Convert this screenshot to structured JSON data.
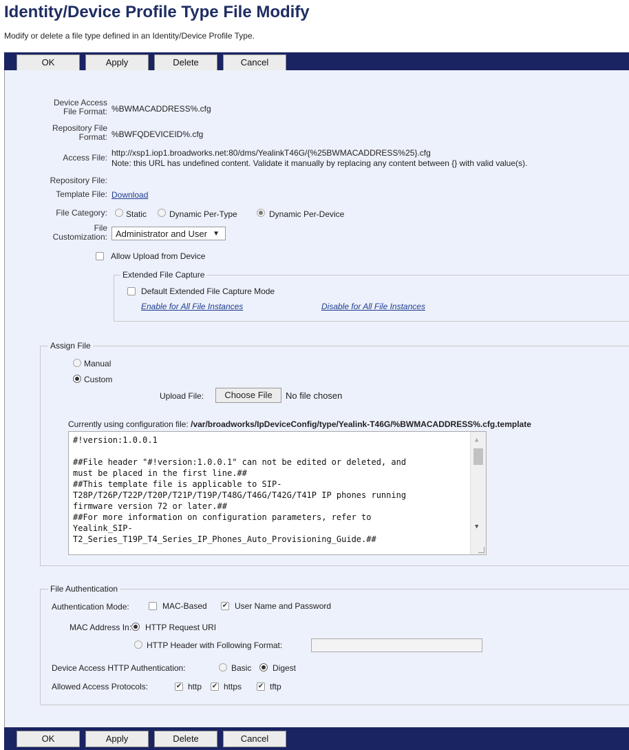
{
  "page": {
    "title": "Identity/Device Profile Type File Modify",
    "subtitle": "Modify or delete a file type defined in an Identity/Device Profile Type."
  },
  "buttons": {
    "ok": "OK",
    "apply": "Apply",
    "delete": "Delete",
    "cancel": "Cancel"
  },
  "fields": {
    "device_access_label": "Device Access File Format:",
    "device_access_value": "%BWMACADDRESS%.cfg",
    "repository_format_label": "Repository File Format:",
    "repository_format_value": "%BWFQDEVICEID%.cfg",
    "access_file_label": "Access File:",
    "access_file_value": "http://xsp1.iop1.broadworks.net:80/dms/YealinkT46G/{%25BWMACADDRESS%25}.cfg",
    "access_file_note": "Note: this URL has undefined content. Validate it manually by replacing any content between {} with valid value(s).",
    "repository_file_label": "Repository File:",
    "template_file_label": "Template File:",
    "template_file_link": "Download",
    "file_category_label": "File Category:",
    "file_category_options": [
      "Static",
      "Dynamic Per-Type",
      "Dynamic Per-Device"
    ],
    "file_category_selected": "Dynamic Per-Device",
    "file_customization_label_1": "File",
    "file_customization_label_2": "Customization:",
    "file_customization_value": "Administrator and User",
    "allow_upload_label": "Allow Upload from Device",
    "allow_upload_checked": false
  },
  "extended_capture": {
    "legend": "Extended File Capture",
    "default_mode_label": "Default Extended File Capture Mode",
    "default_mode_checked": false,
    "enable_all": "Enable for All File Instances",
    "disable_all": "Disable for All File Instances"
  },
  "assign_file": {
    "legend": "Assign File",
    "manual_label": "Manual",
    "custom_label": "Custom",
    "selected": "Custom",
    "upload_label": "Upload File:",
    "choose_button": "Choose File",
    "no_file_text": "No file chosen",
    "config_prefix": "Currently using configuration file:",
    "config_path": "/var/broadworks/IpDeviceConfig/type/Yealink-T46G/%BWMACADDRESS%.cfg.template",
    "template_lines": [
      "#!version:1.0.0.1",
      "",
      "##File header \"#!version:1.0.0.1\" can not be edited or deleted, and",
      "must be placed in the first line.##",
      "##This template file is applicable to SIP-",
      "T28P/T26P/T22P/T20P/T21P/T19P/T48G/T46G/T42G/T41P IP phones running",
      "firmware version 72 or later.##",
      "##For more information on configuration parameters, refer to",
      "Yealink_SIP-",
      "T2_Series_T19P_T4_Series_IP_Phones_Auto_Provisioning_Guide.##"
    ]
  },
  "file_auth": {
    "legend": "File Authentication",
    "auth_mode_label": "Authentication Mode:",
    "mac_based_label": "MAC-Based",
    "mac_based_checked": false,
    "user_pass_label": "User Name and Password",
    "user_pass_checked": true,
    "mac_in_label": "MAC Address In:",
    "http_request_uri": "HTTP Request URI",
    "http_header_label": "HTTP Header with Following Format:",
    "mac_in_selected": "HTTP Request URI",
    "http_header_value": "",
    "device_http_auth_label": "Device Access HTTP Authentication:",
    "basic_label": "Basic",
    "digest_label": "Digest",
    "device_http_auth_selected": "Digest",
    "allowed_protocols_label": "Allowed Access Protocols:",
    "protocols": [
      {
        "name": "http",
        "checked": true
      },
      {
        "name": "https",
        "checked": true
      },
      {
        "name": "tftp",
        "checked": true
      }
    ]
  },
  "colors": {
    "header_blue": "#1a2463",
    "panel_bg": "#edf1fb",
    "title_color": "#1f2d63",
    "link_color": "#1f3d8f"
  }
}
